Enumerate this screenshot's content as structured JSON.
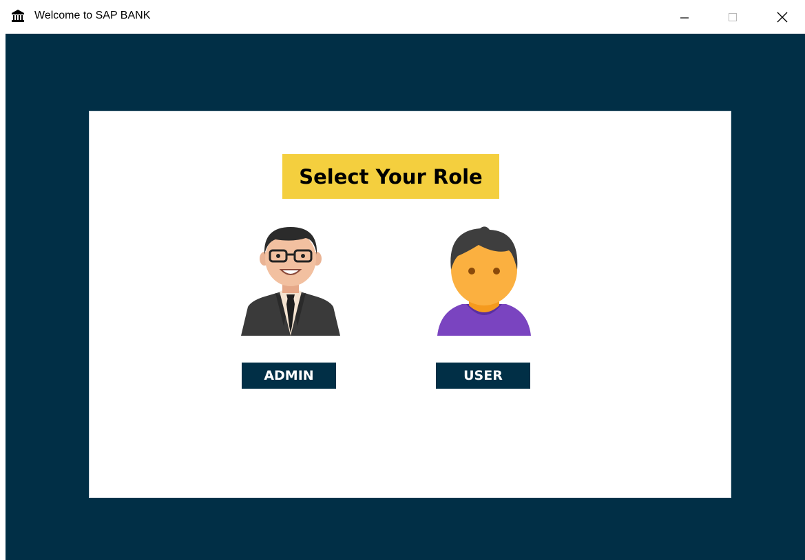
{
  "window": {
    "title": "Welcome to SAP BANK",
    "icon": "bank-icon",
    "controls": [
      "minimize-icon",
      "maximize-icon",
      "close-icon"
    ]
  },
  "colors": {
    "background": "#012f46",
    "card": "#ffffff",
    "heading_bg": "#f4cf3e",
    "button_bg": "#012f46",
    "button_text": "#ffffff"
  },
  "main": {
    "heading": "Select Your Role",
    "roles": [
      {
        "label": "ADMIN",
        "avatar": "admin-avatar-icon"
      },
      {
        "label": "USER",
        "avatar": "user-avatar-icon"
      }
    ]
  }
}
